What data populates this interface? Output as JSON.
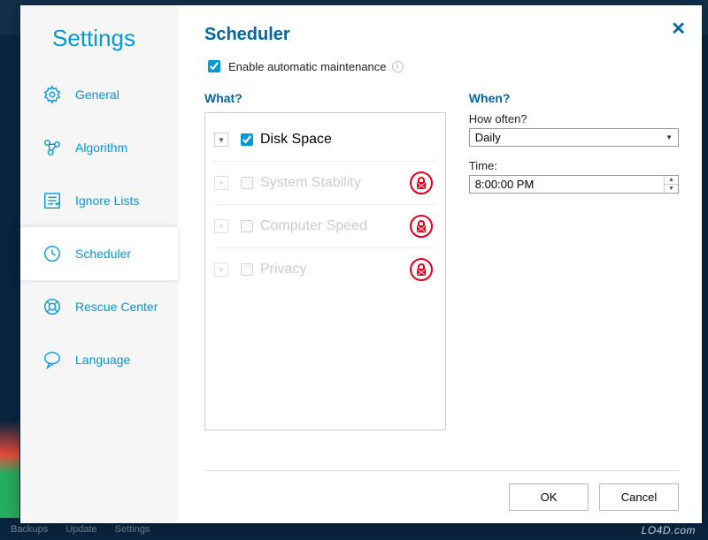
{
  "sidebar": {
    "title": "Settings",
    "items": [
      {
        "label": "General"
      },
      {
        "label": "Algorithm"
      },
      {
        "label": "Ignore Lists"
      },
      {
        "label": "Scheduler"
      },
      {
        "label": "Rescue Center"
      },
      {
        "label": "Language"
      }
    ]
  },
  "main": {
    "title": "Scheduler",
    "enable_label": "Enable automatic maintenance",
    "what_title": "What?",
    "when_title": "When?",
    "how_often_label": "How often?",
    "how_often_value": "Daily",
    "time_label": "Time:",
    "time_value": "8:00:00 PM",
    "what_items": [
      {
        "label": "Disk Space",
        "checked": true,
        "locked": false
      },
      {
        "label": "System Stability",
        "checked": false,
        "locked": true
      },
      {
        "label": "Computer Speed",
        "checked": false,
        "locked": true
      },
      {
        "label": "Privacy",
        "checked": false,
        "locked": true
      }
    ],
    "ok_label": "OK",
    "cancel_label": "Cancel"
  },
  "footer_bar": {
    "left1": "Backups",
    "left2": "Update",
    "left3": "Settings"
  },
  "watermark": "LO4D.com"
}
